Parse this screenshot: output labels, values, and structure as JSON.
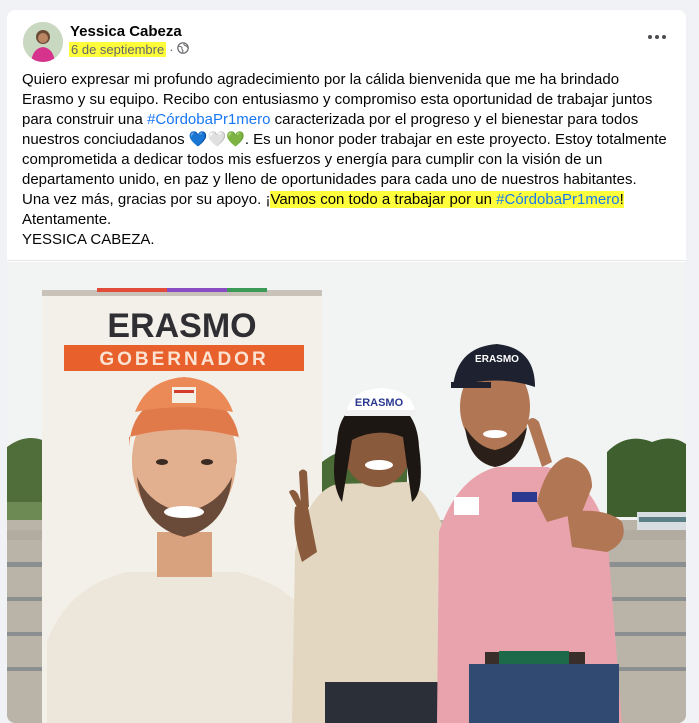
{
  "post": {
    "author": "Yessica Cabeza",
    "date": "6 de septiembre",
    "separator": "·",
    "privacy_icon": "globe-icon",
    "more_icon": "more-options-icon"
  },
  "text": {
    "p1_a": "Quiero expresar mi profundo agradecimiento por la cálida bienvenida que me ha brindado Erasmo y su equipo. Recibo con entusiasmo y compromiso esta oportunidad de trabajar juntos para construir una ",
    "hashtag1": "#CórdobaPr1mero",
    "p1_b": " caracterizada por el progreso y el bienestar para todos nuestros conciudadanos ",
    "emojis": "💙🤍💚",
    "p1_c": ". Es un honor poder trabajar en este proyecto. Estoy totalmente comprometida a dedicar todos mis esfuerzos y energía para cumplir con la visión de un departamento unido, en paz y lleno de oportunidades para cada uno de nuestros habitantes.",
    "p2_a": "Una vez más, gracias por su apoyo. ¡",
    "p2_hl": "Vamos con todo a trabajar por un ",
    "hashtag2": "#CórdobaPr1mero",
    "p2_end": "!",
    "closing": "Atentamente.",
    "signature": "YESSICA CABEZA."
  },
  "photo": {
    "banner_name": "ERASMO",
    "banner_role": "GOBERNADOR",
    "cap1_text": "ERASMO",
    "cap2_text": "ERASMO"
  },
  "colors": {
    "link": "#1877f2",
    "highlight": "#fdfd3a",
    "banner_orange": "#e8612c",
    "shirt_pink": "#e9a3ad"
  }
}
